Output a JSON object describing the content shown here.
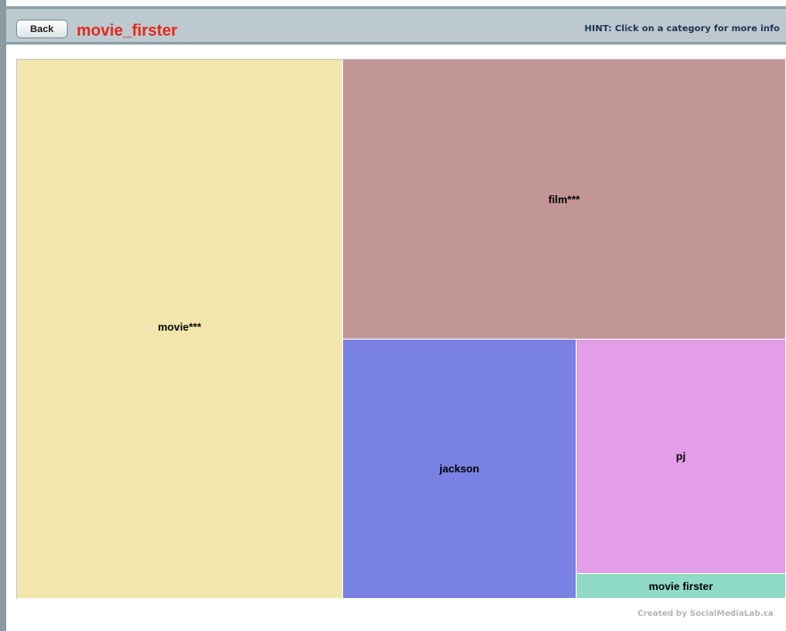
{
  "header": {
    "back_label": "Back",
    "title": "movie_firster",
    "hint": "HINT: Click on a category for more info"
  },
  "treemap": {
    "cells": [
      {
        "label": "movie***",
        "color": "#f3e6ac"
      },
      {
        "label": "film***",
        "color": "#c29596"
      },
      {
        "label": "jackson",
        "color": "#7981e3"
      },
      {
        "label": "pj",
        "color": "#e29ee9"
      },
      {
        "label": "movie firster",
        "color": "#8fdbc5"
      }
    ]
  },
  "footer": {
    "credit": "Created by SocialMediaLab.ca"
  }
}
